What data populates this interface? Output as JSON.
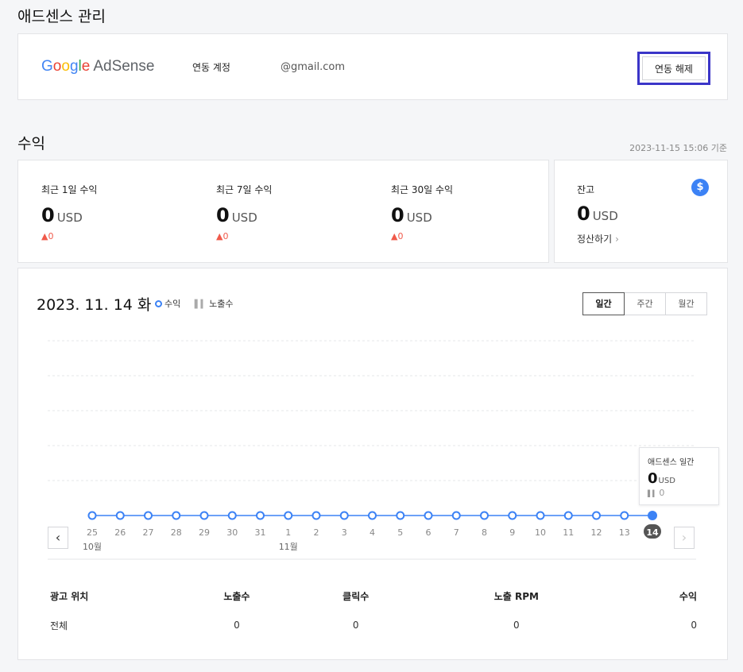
{
  "page": {
    "title": "애드센스 관리"
  },
  "account": {
    "brand_google": [
      "G",
      "o",
      "o",
      "g",
      "l",
      "e"
    ],
    "brand_product": "AdSense",
    "label": "연동 계정",
    "email": "@gmail.com",
    "unlink_label": "연동 해제"
  },
  "revenue": {
    "title": "수익",
    "as_of": "2023-11-15 15:06 기준",
    "cards": [
      {
        "label": "최근 1일 수익",
        "value": "0",
        "unit": "USD",
        "delta": "0"
      },
      {
        "label": "최근 7일 수익",
        "value": "0",
        "unit": "USD",
        "delta": "0"
      },
      {
        "label": "최근 30일 수익",
        "value": "0",
        "unit": "USD",
        "delta": "0"
      }
    ],
    "balance": {
      "label": "잔고",
      "value": "0",
      "unit": "USD",
      "settle_label": "정산하기",
      "icon": "dollar-icon"
    }
  },
  "chart_header": {
    "date": "2023. 11. 14 화",
    "legend_revenue": "수익",
    "legend_impressions": "노출수",
    "tabs": [
      {
        "label": "일간",
        "active": true
      },
      {
        "label": "주간",
        "active": false
      },
      {
        "label": "월간",
        "active": false
      }
    ]
  },
  "chart_data": {
    "type": "line",
    "categories": [
      "25",
      "26",
      "27",
      "28",
      "29",
      "30",
      "31",
      "1",
      "2",
      "3",
      "4",
      "5",
      "6",
      "7",
      "8",
      "9",
      "10",
      "11",
      "12",
      "13",
      "14"
    ],
    "month_labels": [
      {
        "index": 0,
        "label": "10월"
      },
      {
        "index": 7,
        "label": "11월"
      }
    ],
    "series": [
      {
        "name": "수익",
        "values": [
          0,
          0,
          0,
          0,
          0,
          0,
          0,
          0,
          0,
          0,
          0,
          0,
          0,
          0,
          0,
          0,
          0,
          0,
          0,
          0,
          0
        ],
        "color": "#3c82f5"
      },
      {
        "name": "노출수",
        "values": [
          0,
          0,
          0,
          0,
          0,
          0,
          0,
          0,
          0,
          0,
          0,
          0,
          0,
          0,
          0,
          0,
          0,
          0,
          0,
          0,
          0
        ],
        "color": "#aaaaaa"
      }
    ],
    "selected_index": 20,
    "grid": true,
    "ylim": [
      0,
      5
    ]
  },
  "tooltip": {
    "title": "애드센스 일간",
    "value": "0",
    "unit": "USD",
    "impressions": "0"
  },
  "table": {
    "headers": [
      "광고 위치",
      "노출수",
      "클릭수",
      "노출 RPM",
      "수익"
    ],
    "rows": [
      [
        "전체",
        "0",
        "0",
        "0",
        "0"
      ]
    ]
  }
}
